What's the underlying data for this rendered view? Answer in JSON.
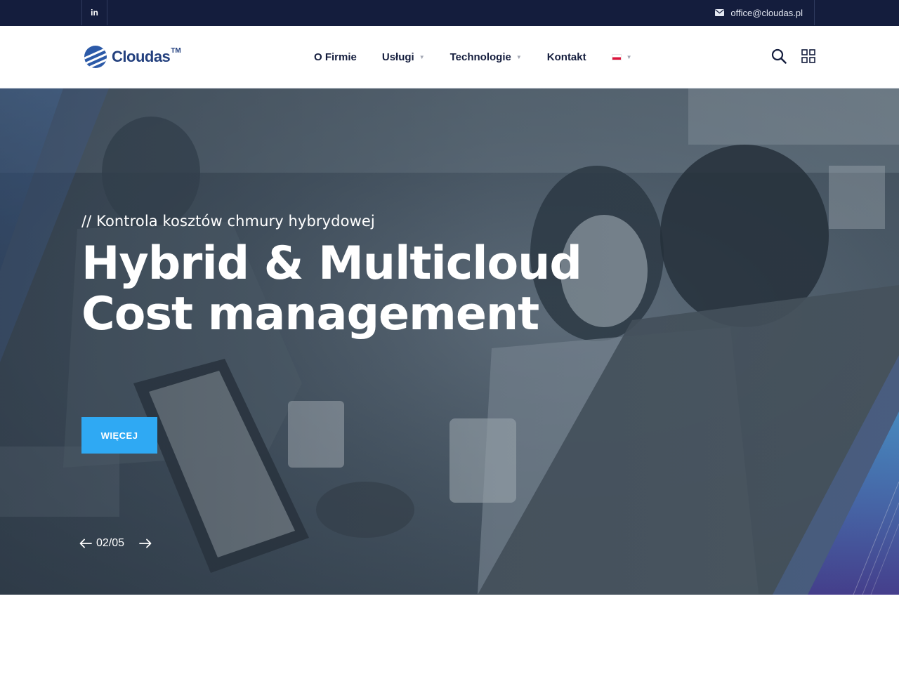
{
  "topbar": {
    "social_label": "in",
    "email": "office@cloudas.pl"
  },
  "header": {
    "logo_text": "Cloudas",
    "logo_tm": "TM",
    "nav": [
      {
        "label": "O Firmie",
        "has_dropdown": false
      },
      {
        "label": "Usługi",
        "has_dropdown": true
      },
      {
        "label": "Technologie",
        "has_dropdown": true
      },
      {
        "label": "Kontakt",
        "has_dropdown": false
      }
    ],
    "language": "pl",
    "icons": [
      "search-icon",
      "grid-menu-icon"
    ]
  },
  "hero": {
    "subtitle": "// Kontrola kosztów chmury hybrydowej",
    "title_line1": "Hybrid & Multicloud",
    "title_line2": "Cost management",
    "button_label": "WIĘCEJ",
    "slide_counter": "02/05"
  },
  "colors": {
    "topbar_bg": "#141d3d",
    "brand_blue": "#23407e",
    "accent_button": "#2fa9f3",
    "nav_text": "#141d3d"
  }
}
